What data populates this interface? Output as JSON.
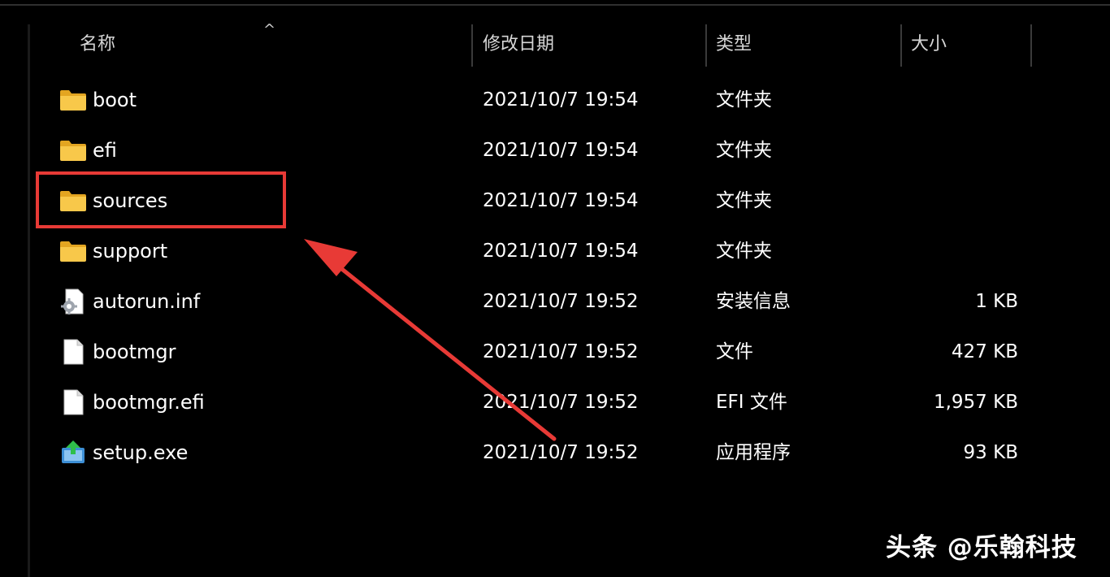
{
  "columns": {
    "name": "名称",
    "modified": "修改日期",
    "type": "类型",
    "size": "大小"
  },
  "sort_indicator": "^",
  "files": [
    {
      "name": "boot",
      "date": "2021/10/7 19:54",
      "type": "文件夹",
      "size": "",
      "icon": "folder-icon"
    },
    {
      "name": "efi",
      "date": "2021/10/7 19:54",
      "type": "文件夹",
      "size": "",
      "icon": "folder-icon"
    },
    {
      "name": "sources",
      "date": "2021/10/7 19:54",
      "type": "文件夹",
      "size": "",
      "icon": "folder-icon"
    },
    {
      "name": "support",
      "date": "2021/10/7 19:54",
      "type": "文件夹",
      "size": "",
      "icon": "folder-icon"
    },
    {
      "name": "autorun.inf",
      "date": "2021/10/7 19:52",
      "type": "安装信息",
      "size": "1 KB",
      "icon": "settings-file-icon"
    },
    {
      "name": "bootmgr",
      "date": "2021/10/7 19:52",
      "type": "文件",
      "size": "427 KB",
      "icon": "file-icon"
    },
    {
      "name": "bootmgr.efi",
      "date": "2021/10/7 19:52",
      "type": "EFI 文件",
      "size": "1,957 KB",
      "icon": "file-icon"
    },
    {
      "name": "setup.exe",
      "date": "2021/10/7 19:52",
      "type": "应用程序",
      "size": "93 KB",
      "icon": "setup-icon"
    }
  ],
  "annotation": {
    "highlighted_item": "sources",
    "color": "#e83a36"
  },
  "watermark": "头条 @乐翰科技",
  "colors": {
    "background": "#000000",
    "text": "#ffffff",
    "folder": "#f4c23c",
    "annotation": "#e83a36"
  }
}
